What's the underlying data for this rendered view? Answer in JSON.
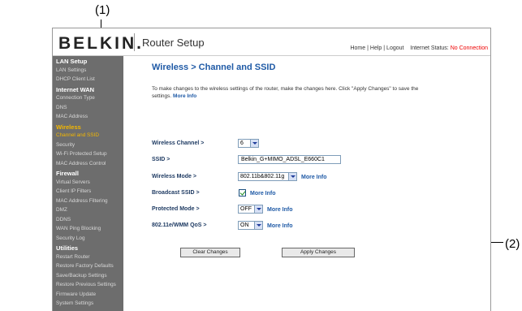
{
  "callouts": {
    "c1": "(1)",
    "c2": "(2)"
  },
  "header": {
    "logo": "BELKIN.",
    "router_setup": "Router Setup",
    "home": "Home",
    "help": "Help",
    "logout": "Logout",
    "sep": "|",
    "internet_status_label": "Internet Status:",
    "internet_status_value": "No Connection"
  },
  "sidebar": [
    {
      "label": "LAN Setup",
      "kind": "head"
    },
    {
      "label": "LAN Settings",
      "kind": "item"
    },
    {
      "label": "DHCP Client List",
      "kind": "item"
    },
    {
      "label": "Internet WAN",
      "kind": "head"
    },
    {
      "label": "Connection Type",
      "kind": "item"
    },
    {
      "label": "DNS",
      "kind": "item"
    },
    {
      "label": "MAC Address",
      "kind": "item"
    },
    {
      "label": "Wireless",
      "kind": "active"
    },
    {
      "label": "Channel and SSID",
      "kind": "current"
    },
    {
      "label": "Security",
      "kind": "item"
    },
    {
      "label": "Wi-Fi Protected Setup",
      "kind": "item"
    },
    {
      "label": "MAC Address Control",
      "kind": "item"
    },
    {
      "label": "Firewall",
      "kind": "head"
    },
    {
      "label": "Virtual Servers",
      "kind": "item"
    },
    {
      "label": "Client IP Filters",
      "kind": "item"
    },
    {
      "label": "MAC Address Filtering",
      "kind": "item"
    },
    {
      "label": "DMZ",
      "kind": "item"
    },
    {
      "label": "DDNS",
      "kind": "item"
    },
    {
      "label": "WAN Ping Blocking",
      "kind": "item"
    },
    {
      "label": "Security Log",
      "kind": "item"
    },
    {
      "label": "Utilities",
      "kind": "head"
    },
    {
      "label": "Restart Router",
      "kind": "item"
    },
    {
      "label": "Restore Factory Defaults",
      "kind": "item"
    },
    {
      "label": "Save/Backup Settings",
      "kind": "item"
    },
    {
      "label": "Restore Previous Settings",
      "kind": "item"
    },
    {
      "label": "Firmware Update",
      "kind": "item"
    },
    {
      "label": "System Settings",
      "kind": "item"
    }
  ],
  "main": {
    "title": "Wireless > Channel and SSID",
    "intro": "To make changes to the wireless settings of the router, make the changes here. Click \"Apply Changes\" to save the settings.",
    "intro_link": "More Info",
    "fields": {
      "channel": {
        "label": "Wireless Channel >",
        "value": "6"
      },
      "ssid": {
        "label": "SSID >",
        "value": "Belkin_G+MIMO_ADSL_E660C1"
      },
      "mode": {
        "label": "Wireless Mode >",
        "value": "802.11b&802.11g",
        "more": "More Info"
      },
      "broadcast": {
        "label": "Broadcast SSID >",
        "checked": true,
        "more": "More Info"
      },
      "protected": {
        "label": "Protected Mode >",
        "value": "OFF",
        "more": "More Info"
      },
      "qos": {
        "label": "802.11e/WMM QoS >",
        "value": "ON",
        "more": "More Info"
      }
    },
    "buttons": {
      "clear": "Clear Changes",
      "apply": "Apply Changes"
    }
  }
}
